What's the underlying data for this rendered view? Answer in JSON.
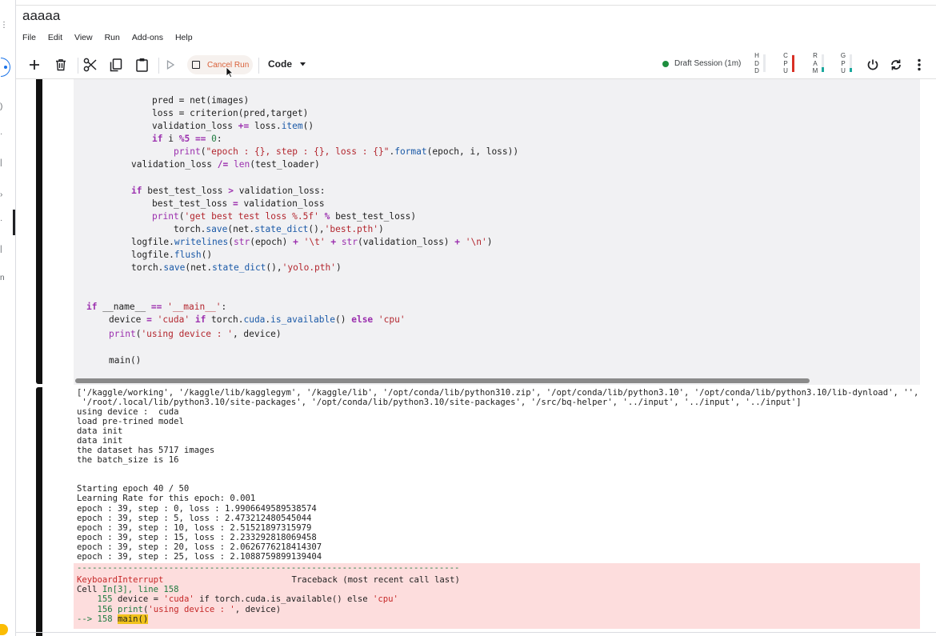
{
  "notebook": {
    "title": "aaaaa"
  },
  "menu": [
    "File",
    "Edit",
    "View",
    "Run",
    "Add-ons",
    "Help"
  ],
  "toolbar": {
    "cancel_run_label": "Cancel Run",
    "cell_type_label": "Code",
    "session_label": "Draft Session (1m)",
    "resources": [
      {
        "letters": [
          "H",
          "D",
          "D"
        ],
        "level": 0.0,
        "color": "#9aa0a6"
      },
      {
        "letters": [
          "C",
          "P",
          "U"
        ],
        "level": 0.95,
        "color": "#d93025"
      },
      {
        "letters": [
          "R",
          "A",
          "M"
        ],
        "level": 0.3,
        "color": "#1aa79d"
      },
      {
        "letters": [
          "G",
          "P",
          "U"
        ],
        "level": 0.25,
        "color": "#1aa79d"
      }
    ]
  },
  "code": {
    "l1": "pred = net(images)",
    "l2": "loss = criterion(pred,target)",
    "l3a": "validation_loss ",
    "l3b": "+=",
    "l3c": " loss.",
    "l3d": "item",
    "l3e": "()",
    "l4a": "if",
    "l4b": " i ",
    "l4c": "%5",
    "l4d": " ",
    "l4e": "==",
    "l4f": " ",
    "l4g": "0",
    "l4h": ":",
    "l5a": "print",
    "l5b": "(",
    "l5c": "\"epoch : {}, step : {}, loss : {}\"",
    "l5d": ".",
    "l5e": "format",
    "l5f": "(epoch, i, loss))",
    "l6a": "validation_loss ",
    "l6b": "/=",
    "l6c": " ",
    "l6d": "len",
    "l6e": "(test_loader)",
    "l7a": "if",
    "l7b": " best_test_loss ",
    "l7c": ">",
    "l7d": " validation_loss:",
    "l8a": "best_test_loss ",
    "l8b": "=",
    "l8c": " validation_loss",
    "l9a": "print",
    "l9b": "(",
    "l9c": "'get best test loss %.5f'",
    "l9d": " ",
    "l9e": "%",
    "l9f": " best_test_loss)",
    "l10a": "torch.",
    "l10b": "save",
    "l10c": "(net.",
    "l10d": "state_dict",
    "l10e": "(),",
    "l10f": "'best.pth'",
    "l10g": ")",
    "l11a": "logfile.",
    "l11b": "writelines",
    "l11c": "(",
    "l11d": "str",
    "l11e": "(epoch) ",
    "l11f": "+",
    "l11g": " ",
    "l11h": "'\\t'",
    "l11i": " ",
    "l11j": "+",
    "l11k": " ",
    "l11l": "str",
    "l11m": "(validation_loss) ",
    "l11n": "+",
    "l11o": " ",
    "l11p": "'\\n'",
    "l11q": ")",
    "l12a": "logfile.",
    "l12b": "flush",
    "l12c": "()",
    "l13a": "torch.",
    "l13b": "save",
    "l13c": "(net.",
    "l13d": "state_dict",
    "l13e": "(),",
    "l13f": "'yolo.pth'",
    "l13g": ")",
    "l14a": "if",
    "l14b": " __name__ ",
    "l14c": "==",
    "l14d": " ",
    "l14e": "'__main__'",
    "l14f": ":",
    "l15a": "device ",
    "l15b": "=",
    "l15c": " ",
    "l15d": "'cuda'",
    "l15e": " ",
    "l15f": "if",
    "l15g": " torch.",
    "l15h": "cuda",
    "l15i": ".",
    "l15j": "is_available",
    "l15k": "() ",
    "l15l": "else",
    "l15m": " ",
    "l15n": "'cpu'",
    "l16a": "print",
    "l16b": "(",
    "l16c": "'using device : '",
    "l16d": ", device)",
    "l17": "main()"
  },
  "output": [
    "['/kaggle/working', '/kaggle/lib/kagglegym', '/kaggle/lib', '/opt/conda/lib/python310.zip', '/opt/conda/lib/python3.10', '/opt/conda/lib/python3.10/lib-dynload', '',",
    " '/root/.local/lib/python3.10/site-packages', '/opt/conda/lib/python3.10/site-packages', '/src/bq-helper', '../input', '../input', '../input']",
    "using device :  cuda",
    "load pre-trined model",
    "data init",
    "data init",
    "the dataset has 5717 images",
    "the batch_size is 16",
    "Starting epoch 40 / 50",
    "Learning Rate for this epoch: 0.001",
    "epoch : 39, step : 0, loss : 1.9906649589538574",
    "epoch : 39, step : 5, loss : 2.473212480545044",
    "epoch : 39, step : 10, loss : 2.51521897315979",
    "epoch : 39, step : 15, loss : 2.233292818069458",
    "epoch : 39, step : 20, loss : 2.0626776218414307",
    "epoch : 39, step : 25, loss : 2.1088759899139404"
  ],
  "error": {
    "separator": "---------------------------------------------------------------------------",
    "exception": "KeyboardInterrupt",
    "traceback_label": "Traceback (most recent call last)",
    "cell_a": "Cell ",
    "cell_b": "In[3], line 158",
    "l155a": "    155",
    "l155b": " device = ",
    "l155c": "'cuda'",
    "l155d": " if torch.cuda.is_available() else ",
    "l155e": "'cpu'",
    "l156a": "    156",
    "l156b": " ",
    "l156c": "print",
    "l156d": "(",
    "l156e": "'using device : '",
    "l156f": ", device)",
    "l158a": "--> 158",
    "l158b": " ",
    "l158c": "main()"
  }
}
